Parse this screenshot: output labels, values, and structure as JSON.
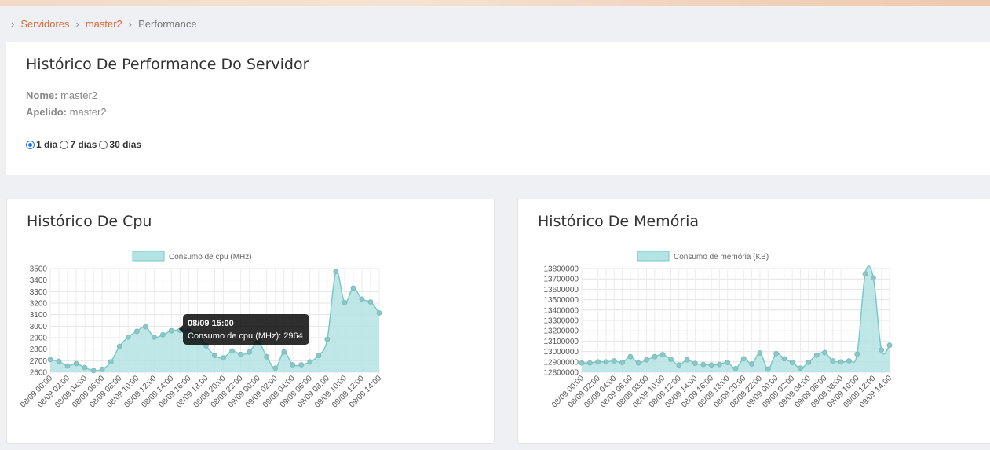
{
  "breadcrumb": {
    "items": [
      "Servidores",
      "master2",
      "Performance"
    ]
  },
  "info": {
    "title": "Histórico De Performance Do Servidor",
    "name_label": "Nome:",
    "name_value": "master2",
    "alias_label": "Apelido:",
    "alias_value": "master2",
    "periods": [
      {
        "label": "1 dia",
        "selected": true
      },
      {
        "label": "7 dias",
        "selected": false
      },
      {
        "label": "30 dias",
        "selected": false
      }
    ]
  },
  "colors": {
    "accent": "#e0683a",
    "series_fill": "#b4e3e3",
    "series_line": "#78c9c9",
    "point": "#8cc7c7"
  },
  "tooltip": {
    "title": "08/09 15:00",
    "body": "Consumo de cpu (MHz): 2964"
  },
  "chart_data": [
    {
      "type": "area",
      "title": "Histórico De Cpu",
      "legend": "Consumo de cpu (MHz)",
      "legend_position": "top",
      "grid": true,
      "ylim": [
        2600,
        3500
      ],
      "yticks": [
        3500,
        3400,
        3300,
        3200,
        3100,
        3000,
        2900,
        2800,
        2700,
        2600
      ],
      "x_ticks": [
        "08/09 00:00",
        "08/09 02:00",
        "08/09 04:00",
        "08/09 06:00",
        "08/09 08:00",
        "08/09 10:00",
        "08/09 12:00",
        "08/09 14:00",
        "08/09 16:00",
        "08/09 18:00",
        "08/09 20:00",
        "08/09 22:00",
        "09/09 00:00",
        "09/09 02:00",
        "09/09 04:00",
        "09/09 06:00",
        "09/09 08:00",
        "09/09 10:00",
        "09/09 12:00",
        "09/09 14:00"
      ],
      "series": [
        {
          "name": "Consumo de cpu (MHz)",
          "values": [
            2710,
            2695,
            2655,
            2675,
            2640,
            2615,
            2625,
            2690,
            2825,
            2905,
            2955,
            2995,
            2905,
            2925,
            2960,
            2964,
            2960,
            2925,
            2830,
            2745,
            2725,
            2785,
            2755,
            2775,
            2865,
            2735,
            2635,
            2775,
            2665,
            2665,
            2690,
            2745,
            2885,
            3475,
            3205,
            3330,
            3235,
            3210,
            3115
          ]
        }
      ]
    },
    {
      "type": "area",
      "title": "Histórico De Memória",
      "legend": "Consumo de memória (KB)",
      "legend_position": "top",
      "grid": true,
      "ylim": [
        12800000,
        13800000
      ],
      "yticks": [
        13800000,
        13700000,
        13600000,
        13500000,
        13400000,
        13300000,
        13200000,
        13100000,
        13000000,
        12900000,
        12800000
      ],
      "x_ticks": [
        "08/09 00:00",
        "08/09 02:00",
        "08/09 04:00",
        "08/09 06:00",
        "08/09 08:00",
        "08/09 10:00",
        "08/09 12:00",
        "08/09 14:00",
        "08/09 16:00",
        "08/09 18:00",
        "08/09 20:00",
        "08/09 22:00",
        "09/09 00:00",
        "09/09 02:00",
        "09/09 04:00",
        "09/09 06:00",
        "09/09 08:00",
        "09/09 10:00",
        "09/09 12:00",
        "09/09 14:00"
      ],
      "series": [
        {
          "name": "Consumo de memória (KB)",
          "values": [
            12890000,
            12890000,
            12900000,
            12900000,
            12910000,
            12895000,
            12950000,
            12890000,
            12920000,
            12950000,
            12970000,
            12925000,
            12870000,
            12920000,
            12885000,
            12875000,
            12870000,
            12875000,
            12895000,
            12835000,
            12930000,
            12880000,
            12985000,
            12830000,
            12980000,
            12930000,
            12895000,
            12840000,
            12895000,
            12965000,
            12990000,
            12910000,
            12900000,
            12910000,
            12975000,
            13750000,
            13710000,
            13015000,
            13060000
          ]
        }
      ]
    }
  ]
}
